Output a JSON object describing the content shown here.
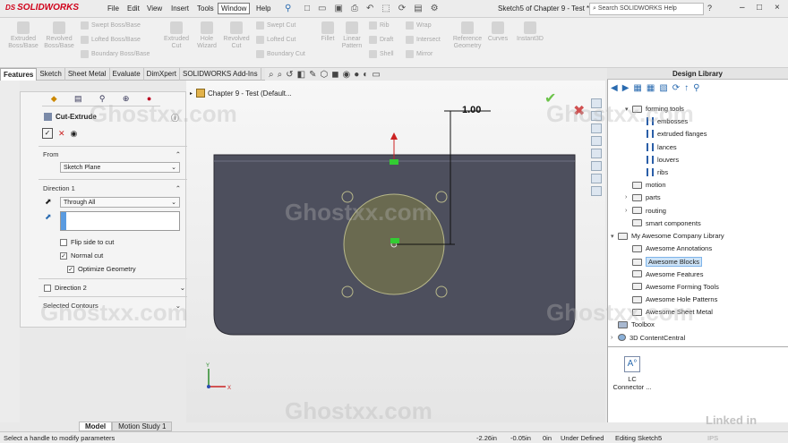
{
  "app": {
    "name": "SOLIDWORKS",
    "doc_title": "Sketch5 of Chapter 9 - Test *",
    "search_placeholder": "Search SOLIDWORKS Help"
  },
  "menu": [
    "File",
    "Edit",
    "View",
    "Insert",
    "Tools",
    "Window",
    "Help"
  ],
  "menu_active": "Window",
  "toolbar": {
    "big": [
      {
        "label1": "Extruded",
        "label2": "Boss/Base"
      },
      {
        "label1": "Revolved",
        "label2": "Boss/Base"
      },
      {
        "label1": "Extruded",
        "label2": "Cut"
      },
      {
        "label1": "Hole",
        "label2": "Wizard"
      },
      {
        "label1": "Revolved",
        "label2": "Cut"
      },
      {
        "label1": "Fillet",
        "label2": ""
      },
      {
        "label1": "Linear",
        "label2": "Pattern"
      },
      {
        "label1": "Reference",
        "label2": "Geometry"
      },
      {
        "label1": "Curves",
        "label2": ""
      },
      {
        "label1": "Instant3D",
        "label2": ""
      }
    ],
    "small_col1": [
      "Swept Boss/Base",
      "Lofted Boss/Base",
      "Boundary Boss/Base"
    ],
    "small_col2": [
      "Swept Cut",
      "Lofted Cut",
      "Boundary Cut"
    ],
    "small_col3": [
      "Rib",
      "Draft",
      "Shell"
    ],
    "small_col4": [
      "Wrap",
      "Intersect",
      "Mirror"
    ]
  },
  "tabs": [
    "Features",
    "Sketch",
    "Sheet Metal",
    "Evaluate",
    "DimXpert",
    "SOLIDWORKS Add-Ins"
  ],
  "tabs_active": "Features",
  "tree_breadcrumb": "Chapter 9 - Test  (Default...",
  "property_manager": {
    "title": "Cut-Extrude",
    "from_label": "From",
    "from_value": "Sketch Plane",
    "direction1_label": "Direction 1",
    "direction1_value": "Through All",
    "flip_side": "Flip side to cut",
    "normal_cut": "Normal cut",
    "optimize": "Optimize Geometry",
    "direction2_label": "Direction 2",
    "selected_contours": "Selected Contours"
  },
  "dimension": "1.00",
  "design_library": {
    "title": "Design Library",
    "items": [
      {
        "label": "forming tools",
        "type": "folder",
        "indent": 1,
        "arrow": "▾"
      },
      {
        "label": "embosses",
        "type": "feat",
        "indent": 2,
        "arrow": ""
      },
      {
        "label": "extruded flanges",
        "type": "feat",
        "indent": 2,
        "arrow": ""
      },
      {
        "label": "lances",
        "type": "feat",
        "indent": 2,
        "arrow": ""
      },
      {
        "label": "louvers",
        "type": "feat",
        "indent": 2,
        "arrow": ""
      },
      {
        "label": "ribs",
        "type": "feat",
        "indent": 2,
        "arrow": ""
      },
      {
        "label": "motion",
        "type": "folder",
        "indent": 1,
        "arrow": ""
      },
      {
        "label": "parts",
        "type": "folder",
        "indent": 1,
        "arrow": "›"
      },
      {
        "label": "routing",
        "type": "folder",
        "indent": 1,
        "arrow": "›"
      },
      {
        "label": "smart components",
        "type": "folder",
        "indent": 1,
        "arrow": ""
      },
      {
        "label": "My Awesome Company Library",
        "type": "folder",
        "indent": 0,
        "arrow": "▾"
      },
      {
        "label": "Awesome Annotations",
        "type": "folder",
        "indent": 1,
        "arrow": ""
      },
      {
        "label": "Awesome Blocks",
        "type": "folder",
        "indent": 1,
        "arrow": "",
        "selected": true
      },
      {
        "label": "Awesome Features",
        "type": "folder",
        "indent": 1,
        "arrow": ""
      },
      {
        "label": "Awesome Forming Tools",
        "type": "folder",
        "indent": 1,
        "arrow": ""
      },
      {
        "label": "Awesome Hole Patterns",
        "type": "folder",
        "indent": 1,
        "arrow": ""
      },
      {
        "label": "Awesome Sheet Metal",
        "type": "folder",
        "indent": 1,
        "arrow": ""
      },
      {
        "label": "Toolbox",
        "type": "toolbox",
        "indent": 0,
        "arrow": ""
      },
      {
        "label": "3D ContentCentral",
        "type": "globe",
        "indent": 0,
        "arrow": "›"
      }
    ],
    "preview_label1": "LC",
    "preview_label2": "Connector ..."
  },
  "bottom_tabs": [
    "Model",
    "Motion Study 1"
  ],
  "status": {
    "message": "Select a handle to modify parameters",
    "x": "-2.26in",
    "y": "-0.05in",
    "z": "0in",
    "state": "Under Defined",
    "editing": "Editing Sketch5",
    "units": "IPS"
  },
  "watermark": "Ghostxx.com",
  "linkedin": "Linked in",
  "colors": {
    "part": "#4d4f5d",
    "circle": "#6a6a50",
    "accent": "#2a6bb0",
    "red": "#d0021b"
  }
}
